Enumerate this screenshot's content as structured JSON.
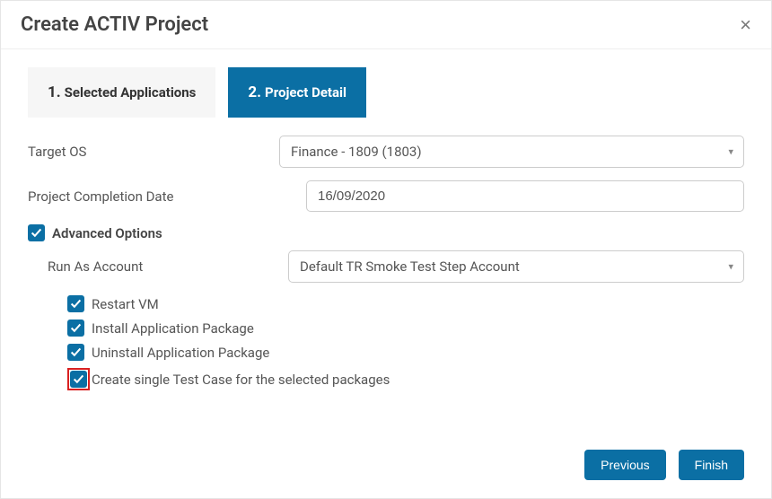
{
  "header": {
    "title": "Create ACTIV Project",
    "close": "×"
  },
  "tabs": [
    {
      "num": "1.",
      "label": "Selected Applications",
      "active": false
    },
    {
      "num": "2.",
      "label": "Project Detail",
      "active": true
    }
  ],
  "form": {
    "target_os_label": "Target OS",
    "target_os_value": "Finance - 1809 (1803)",
    "completion_label": "Project Completion Date",
    "completion_value": "16/09/2020",
    "advanced_label": "Advanced Options",
    "run_as_label": "Run As Account",
    "run_as_value": "Default TR Smoke Test Step Account",
    "restart_vm_label": "Restart VM",
    "install_pkg_label": "Install Application Package",
    "uninstall_pkg_label": "Uninstall Application Package",
    "single_tc_label": "Create single Test Case for the selected packages"
  },
  "footer": {
    "previous": "Previous",
    "finish": "Finish"
  }
}
